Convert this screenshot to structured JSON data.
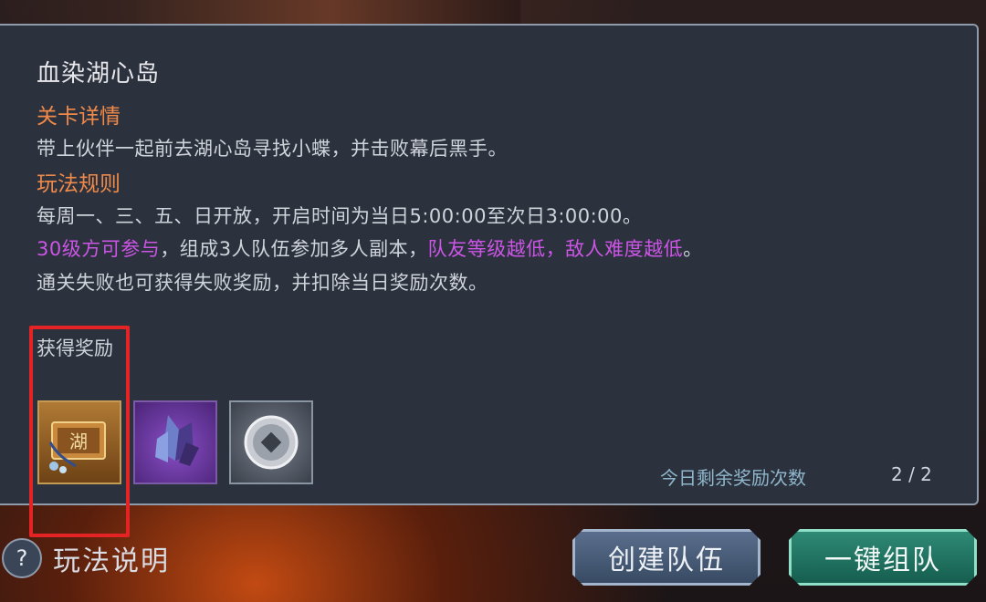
{
  "panel": {
    "title": "血染湖心岛",
    "stage_details_heading": "关卡详情",
    "stage_details_text": "带上伙伴一起前去湖心岛寻找小蝶，并击败幕后黑手。",
    "rules_heading": "玩法规则",
    "rules_line1": "每周一、三、五、日开放，开启时间为当日5:00:00至次日3:00:00。",
    "rules_line2_part1": "30级方可参与",
    "rules_line2_part2": "，组成3人队伍参加多人副本，",
    "rules_line2_part3": "队友等级越低，敌人难度越低",
    "rules_line2_part4": "。",
    "rules_line3": "通关失败也可获得失败奖励，并扣除当日奖励次数。",
    "reward_heading": "获得奖励",
    "reward_items": [
      {
        "icon": "lake-chest-icon",
        "glyph": "湖"
      },
      {
        "icon": "purple-crystal-icon"
      },
      {
        "icon": "silver-coin-icon"
      }
    ],
    "remaining_label": "今日剩余奖励次数",
    "remaining_count": "2 / 2"
  },
  "footer": {
    "help_icon": "?",
    "help_label": "玩法说明",
    "create_team_button": "创建队伍",
    "quick_team_button": "一键组队"
  },
  "colors": {
    "panel_bg": "#2b313d",
    "heading_orange": "#f08a4a",
    "highlight_purple": "#cc55e6",
    "remaining_blue": "#8fb6cc",
    "annotation_red": "#e42424",
    "create_button": "#4b5f7c",
    "quick_button": "#1f7564"
  }
}
